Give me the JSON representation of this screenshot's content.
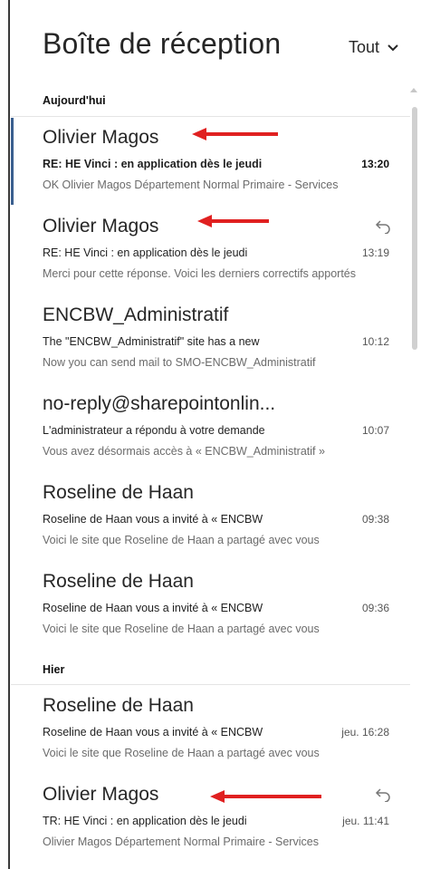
{
  "header": {
    "title": "Boîte de réception",
    "filter_label": "Tout"
  },
  "groups": [
    {
      "label": "Aujourd'hui"
    },
    {
      "label": "Hier"
    }
  ],
  "messages": [
    {
      "sender": "Olivier Magos",
      "subject": "RE: HE Vinci : en application dès le jeudi",
      "time": "13:20",
      "preview": "OK  Olivier Magos Département Normal Primaire - Services",
      "unread": true,
      "selected": true,
      "replied": false
    },
    {
      "sender": "Olivier Magos",
      "subject": "RE: HE Vinci : en application dès le jeudi",
      "time": "13:19",
      "preview": "Merci pour cette réponse. Voici les derniers correctifs apportés",
      "unread": false,
      "selected": false,
      "replied": true
    },
    {
      "sender": "ENCBW_Administratif",
      "subject": "The \"ENCBW_Administratif\" site has a new",
      "time": "10:12",
      "preview": "Now you can send mail to SMO-ENCBW_Administratif",
      "unread": false,
      "selected": false,
      "replied": false
    },
    {
      "sender": "no-reply@sharepointonlin...",
      "subject": "L'administrateur a répondu à votre demande",
      "time": "10:07",
      "preview": "Vous avez désormais accès à « ENCBW_Administratif »",
      "unread": false,
      "selected": false,
      "replied": false
    },
    {
      "sender": "Roseline de Haan",
      "subject": "Roseline de Haan vous a invité à « ENCBW",
      "time": "09:38",
      "preview": "Voici le site que Roseline de Haan a partagé avec vous",
      "unread": false,
      "selected": false,
      "replied": false
    },
    {
      "sender": "Roseline de Haan",
      "subject": "Roseline de Haan vous a invité à « ENCBW",
      "time": "09:36",
      "preview": "Voici le site que Roseline de Haan a partagé avec vous",
      "unread": false,
      "selected": false,
      "replied": false
    },
    {
      "sender": "Roseline de Haan",
      "subject": "Roseline de Haan vous a invité à « ENCBW",
      "time": "jeu. 16:28",
      "preview": "Voici le site que Roseline de Haan a partagé avec vous",
      "unread": false,
      "selected": false,
      "replied": false
    },
    {
      "sender": "Olivier Magos",
      "subject": "TR: HE Vinci : en application dès le jeudi",
      "time": "jeu. 11:41",
      "preview": "Olivier Magos Département Normal Primaire - Services",
      "unread": false,
      "selected": false,
      "replied": true
    }
  ],
  "colors": {
    "selected_bar": "#3a5f8f",
    "annotation_arrow": "#e02020"
  }
}
